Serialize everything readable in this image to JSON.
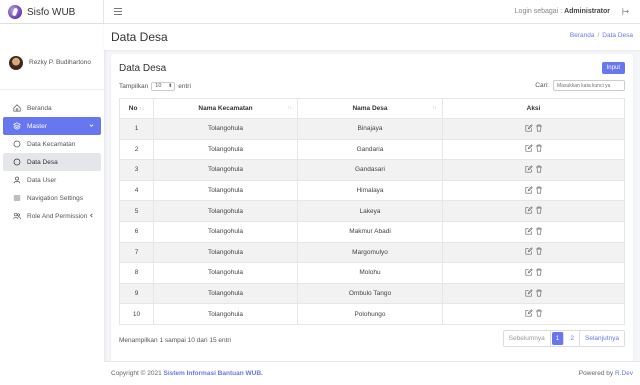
{
  "app": {
    "name": "Sisfo WUB"
  },
  "topbar": {
    "login_prefix": "Login sebagai : ",
    "login_user": "Administrator"
  },
  "sidebar": {
    "user_name": "Rezky P. Budihartono",
    "items": [
      {
        "label": "Beranda",
        "icon": "home-icon"
      },
      {
        "label": "Master",
        "icon": "layers-icon"
      },
      {
        "label": "Data Kecamatan",
        "icon": "circle-icon"
      },
      {
        "label": "Data Desa",
        "icon": "circle-icon"
      },
      {
        "label": "Data User",
        "icon": "user-icon"
      },
      {
        "label": "Navigation Settings",
        "icon": "bars-icon"
      },
      {
        "label": "Role And Permission",
        "icon": "users-icon"
      }
    ]
  },
  "header": {
    "title": "Data Desa",
    "breadcrumb": [
      "Beranda",
      "Data Desa"
    ]
  },
  "card": {
    "title": "Data Desa",
    "input_button": "Input",
    "show_prefix": "Tampilkan",
    "show_value": "10",
    "show_suffix": "entri",
    "search_label": "Cari:",
    "search_placeholder": "Masukkan kata kunci ya",
    "columns": [
      "No",
      "Nama Kecamatan",
      "Nama Desa",
      "Aksi"
    ],
    "rows": [
      {
        "no": "1",
        "kecamatan": "Tolangohula",
        "desa": "Binajaya"
      },
      {
        "no": "2",
        "kecamatan": "Tolangohula",
        "desa": "Gandaria"
      },
      {
        "no": "3",
        "kecamatan": "Tolangohula",
        "desa": "Gandasari"
      },
      {
        "no": "4",
        "kecamatan": "Tolangohula",
        "desa": "Himalaya"
      },
      {
        "no": "5",
        "kecamatan": "Tolangohula",
        "desa": "Lakeya"
      },
      {
        "no": "6",
        "kecamatan": "Tolangohula",
        "desa": "Makmur Abadi"
      },
      {
        "no": "7",
        "kecamatan": "Tolangohula",
        "desa": "Margomulyo"
      },
      {
        "no": "8",
        "kecamatan": "Tolangohula",
        "desa": "Molohu"
      },
      {
        "no": "9",
        "kecamatan": "Tolangohula",
        "desa": "Ombulo Tango"
      },
      {
        "no": "10",
        "kecamatan": "Tolangohula",
        "desa": "Polohungo"
      }
    ],
    "info": "Menampilkan 1 sampai 10 dari 15 entri",
    "pagination": {
      "prev": "Sebelumnya",
      "pages": [
        "1",
        "2"
      ],
      "next": "Selanjutnya"
    }
  },
  "footer": {
    "copyright": "Copyright © 2021 ",
    "link": "Sistem Informasi Bantuan WUB.",
    "powered": "Powered by ",
    "powered_link": "R.Dev"
  },
  "colors": {
    "accent": "#6777ef"
  }
}
